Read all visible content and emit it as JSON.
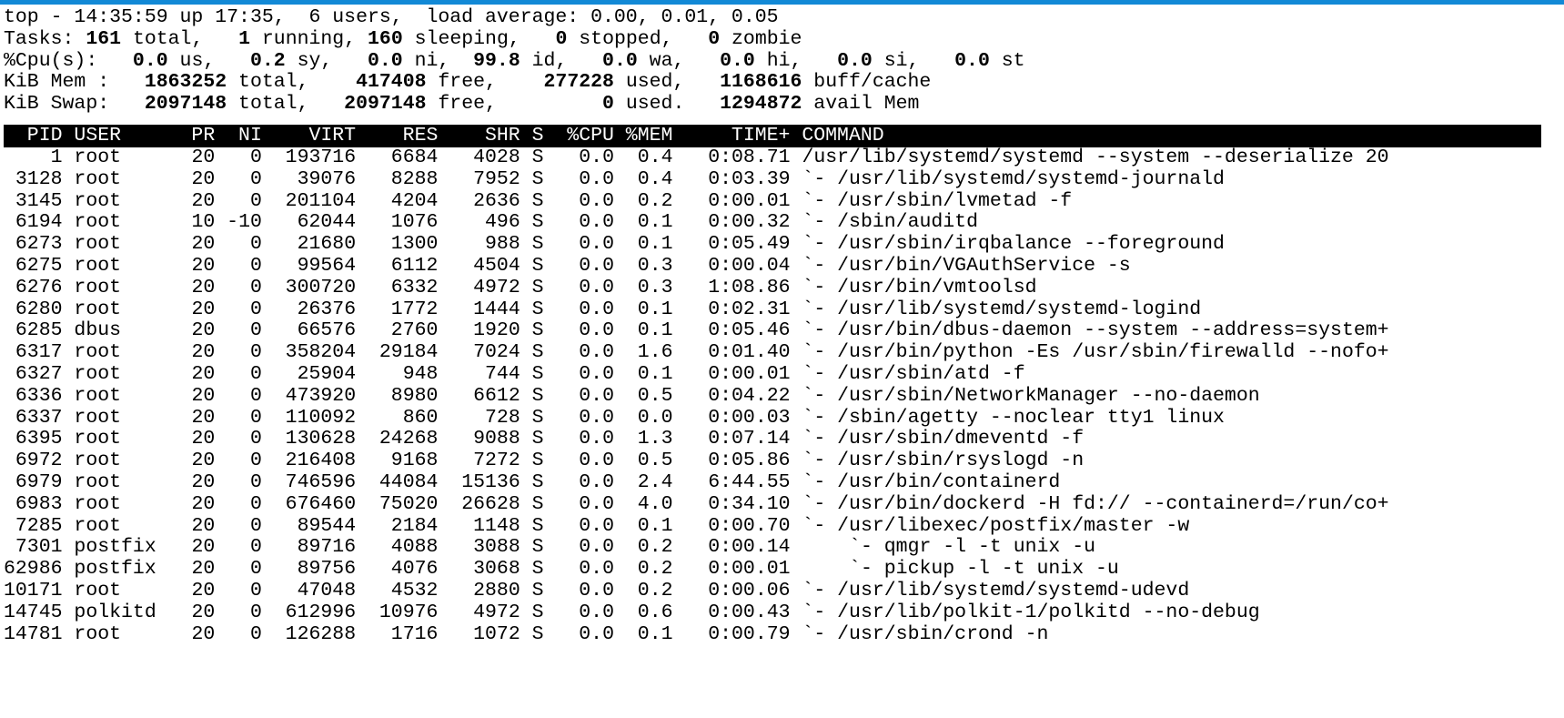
{
  "window": {
    "accent_color": "#1289d6",
    "background_color": "#ffffff",
    "foreground_color": "#000000",
    "header_bar_background": "#000000",
    "header_bar_foreground": "#ffffff"
  },
  "summary": {
    "uptime_line": {
      "program": "top",
      "separator": "-",
      "time": "14:35:59",
      "up_label": "up",
      "uptime": "17:35,",
      "users_count": "6",
      "users_label": "users,",
      "load_label": "load average:",
      "load_1min": "0.00,",
      "load_5min": "0.01,",
      "load_15min": "0.05",
      "text": "top - 14:35:59 up 17:35,  6 users,  load average: 0.00, 0.01, 0.05"
    },
    "tasks_line": {
      "label": "Tasks:",
      "total": "161",
      "total_label": "total,",
      "running": "1",
      "running_label": "running,",
      "sleeping": "160",
      "sleeping_label": "sleeping,",
      "stopped": "0",
      "stopped_label": "stopped,",
      "zombie": "0",
      "zombie_label": "zombie"
    },
    "cpu_line": {
      "label": "%Cpu(s):",
      "us": "0.0",
      "us_label": "us,",
      "sy": "0.2",
      "sy_label": "sy,",
      "ni": "0.0",
      "ni_label": "ni,",
      "id": "99.8",
      "id_label": "id,",
      "wa": "0.0",
      "wa_label": "wa,",
      "hi": "0.0",
      "hi_label": "hi,",
      "si": "0.0",
      "si_label": "si,",
      "st": "0.0",
      "st_label": "st"
    },
    "mem_line": {
      "label": "KiB Mem :",
      "total": "1863252",
      "total_label": "total,",
      "free": "417408",
      "free_label": "free,",
      "used": "277228",
      "used_label": "used,",
      "buff_cache": "1168616",
      "buff_cache_label": "buff/cache"
    },
    "swap_line": {
      "label": "KiB Swap:",
      "total": "2097148",
      "total_label": "total,",
      "free": "2097148",
      "free_label": "free,",
      "used": "0",
      "used_label": "used.",
      "avail": "1294872",
      "avail_label": "avail Mem"
    }
  },
  "columns": {
    "pid": "PID",
    "user": "USER",
    "pr": "PR",
    "ni": "NI",
    "virt": "VIRT",
    "res": "RES",
    "shr": "SHR",
    "s": "S",
    "cpu": "%CPU",
    "mem": "%MEM",
    "time": "TIME+",
    "command": "COMMAND",
    "header_text": "  PID USER      PR  NI    VIRT    RES    SHR S  %CPU %MEM     TIME+ COMMAND"
  },
  "processes": [
    {
      "pid": "1",
      "user": "root",
      "pr": "20",
      "ni": "0",
      "virt": "193716",
      "res": "6684",
      "shr": "4028",
      "s": "S",
      "cpu": "0.0",
      "mem": "0.4",
      "time": "0:08.71",
      "indent": 0,
      "tree": "",
      "command": "/usr/lib/systemd/systemd --system --deserialize 20"
    },
    {
      "pid": "3128",
      "user": "root",
      "pr": "20",
      "ni": "0",
      "virt": "39076",
      "res": "8288",
      "shr": "7952",
      "s": "S",
      "cpu": "0.0",
      "mem": "0.4",
      "time": "0:03.39",
      "indent": 0,
      "tree": "`- ",
      "command": "/usr/lib/systemd/systemd-journald"
    },
    {
      "pid": "3145",
      "user": "root",
      "pr": "20",
      "ni": "0",
      "virt": "201104",
      "res": "4204",
      "shr": "2636",
      "s": "S",
      "cpu": "0.0",
      "mem": "0.2",
      "time": "0:00.01",
      "indent": 0,
      "tree": "`- ",
      "command": "/usr/sbin/lvmetad -f"
    },
    {
      "pid": "6194",
      "user": "root",
      "pr": "10",
      "ni": "-10",
      "virt": "62044",
      "res": "1076",
      "shr": "496",
      "s": "S",
      "cpu": "0.0",
      "mem": "0.1",
      "time": "0:00.32",
      "indent": 0,
      "tree": "`- ",
      "command": "/sbin/auditd"
    },
    {
      "pid": "6273",
      "user": "root",
      "pr": "20",
      "ni": "0",
      "virt": "21680",
      "res": "1300",
      "shr": "988",
      "s": "S",
      "cpu": "0.0",
      "mem": "0.1",
      "time": "0:05.49",
      "indent": 0,
      "tree": "`- ",
      "command": "/usr/sbin/irqbalance --foreground"
    },
    {
      "pid": "6275",
      "user": "root",
      "pr": "20",
      "ni": "0",
      "virt": "99564",
      "res": "6112",
      "shr": "4504",
      "s": "S",
      "cpu": "0.0",
      "mem": "0.3",
      "time": "0:00.04",
      "indent": 0,
      "tree": "`- ",
      "command": "/usr/bin/VGAuthService -s"
    },
    {
      "pid": "6276",
      "user": "root",
      "pr": "20",
      "ni": "0",
      "virt": "300720",
      "res": "6332",
      "shr": "4972",
      "s": "S",
      "cpu": "0.0",
      "mem": "0.3",
      "time": "1:08.86",
      "indent": 0,
      "tree": "`- ",
      "command": "/usr/bin/vmtoolsd"
    },
    {
      "pid": "6280",
      "user": "root",
      "pr": "20",
      "ni": "0",
      "virt": "26376",
      "res": "1772",
      "shr": "1444",
      "s": "S",
      "cpu": "0.0",
      "mem": "0.1",
      "time": "0:02.31",
      "indent": 0,
      "tree": "`- ",
      "command": "/usr/lib/systemd/systemd-logind"
    },
    {
      "pid": "6285",
      "user": "dbus",
      "pr": "20",
      "ni": "0",
      "virt": "66576",
      "res": "2760",
      "shr": "1920",
      "s": "S",
      "cpu": "0.0",
      "mem": "0.1",
      "time": "0:05.46",
      "indent": 0,
      "tree": "`- ",
      "command": "/usr/bin/dbus-daemon --system --address=system+"
    },
    {
      "pid": "6317",
      "user": "root",
      "pr": "20",
      "ni": "0",
      "virt": "358204",
      "res": "29184",
      "shr": "7024",
      "s": "S",
      "cpu": "0.0",
      "mem": "1.6",
      "time": "0:01.40",
      "indent": 0,
      "tree": "`- ",
      "command": "/usr/bin/python -Es /usr/sbin/firewalld --nofo+"
    },
    {
      "pid": "6327",
      "user": "root",
      "pr": "20",
      "ni": "0",
      "virt": "25904",
      "res": "948",
      "shr": "744",
      "s": "S",
      "cpu": "0.0",
      "mem": "0.1",
      "time": "0:00.01",
      "indent": 0,
      "tree": "`- ",
      "command": "/usr/sbin/atd -f"
    },
    {
      "pid": "6336",
      "user": "root",
      "pr": "20",
      "ni": "0",
      "virt": "473920",
      "res": "8980",
      "shr": "6612",
      "s": "S",
      "cpu": "0.0",
      "mem": "0.5",
      "time": "0:04.22",
      "indent": 0,
      "tree": "`- ",
      "command": "/usr/sbin/NetworkManager --no-daemon"
    },
    {
      "pid": "6337",
      "user": "root",
      "pr": "20",
      "ni": "0",
      "virt": "110092",
      "res": "860",
      "shr": "728",
      "s": "S",
      "cpu": "0.0",
      "mem": "0.0",
      "time": "0:00.03",
      "indent": 0,
      "tree": "`- ",
      "command": "/sbin/agetty --noclear tty1 linux"
    },
    {
      "pid": "6395",
      "user": "root",
      "pr": "20",
      "ni": "0",
      "virt": "130628",
      "res": "24268",
      "shr": "9088",
      "s": "S",
      "cpu": "0.0",
      "mem": "1.3",
      "time": "0:07.14",
      "indent": 0,
      "tree": "`- ",
      "command": "/usr/sbin/dmeventd -f"
    },
    {
      "pid": "6972",
      "user": "root",
      "pr": "20",
      "ni": "0",
      "virt": "216408",
      "res": "9168",
      "shr": "7272",
      "s": "S",
      "cpu": "0.0",
      "mem": "0.5",
      "time": "0:05.86",
      "indent": 0,
      "tree": "`- ",
      "command": "/usr/sbin/rsyslogd -n"
    },
    {
      "pid": "6979",
      "user": "root",
      "pr": "20",
      "ni": "0",
      "virt": "746596",
      "res": "44084",
      "shr": "15136",
      "s": "S",
      "cpu": "0.0",
      "mem": "2.4",
      "time": "6:44.55",
      "indent": 0,
      "tree": "`- ",
      "command": "/usr/bin/containerd"
    },
    {
      "pid": "6983",
      "user": "root",
      "pr": "20",
      "ni": "0",
      "virt": "676460",
      "res": "75020",
      "shr": "26628",
      "s": "S",
      "cpu": "0.0",
      "mem": "4.0",
      "time": "0:34.10",
      "indent": 0,
      "tree": "`- ",
      "command": "/usr/bin/dockerd -H fd:// --containerd=/run/co+"
    },
    {
      "pid": "7285",
      "user": "root",
      "pr": "20",
      "ni": "0",
      "virt": "89544",
      "res": "2184",
      "shr": "1148",
      "s": "S",
      "cpu": "0.0",
      "mem": "0.1",
      "time": "0:00.70",
      "indent": 0,
      "tree": "`- ",
      "command": "/usr/libexec/postfix/master -w"
    },
    {
      "pid": "7301",
      "user": "postfix",
      "pr": "20",
      "ni": "0",
      "virt": "89716",
      "res": "4088",
      "shr": "3088",
      "s": "S",
      "cpu": "0.0",
      "mem": "0.2",
      "time": "0:00.14",
      "indent": 1,
      "tree": "`- ",
      "command": "qmgr -l -t unix -u"
    },
    {
      "pid": "62986",
      "user": "postfix",
      "pr": "20",
      "ni": "0",
      "virt": "89756",
      "res": "4076",
      "shr": "3068",
      "s": "S",
      "cpu": "0.0",
      "mem": "0.2",
      "time": "0:00.01",
      "indent": 1,
      "tree": "`- ",
      "command": "pickup -l -t unix -u"
    },
    {
      "pid": "10171",
      "user": "root",
      "pr": "20",
      "ni": "0",
      "virt": "47048",
      "res": "4532",
      "shr": "2880",
      "s": "S",
      "cpu": "0.0",
      "mem": "0.2",
      "time": "0:00.06",
      "indent": 0,
      "tree": "`- ",
      "command": "/usr/lib/systemd/systemd-udevd"
    },
    {
      "pid": "14745",
      "user": "polkitd",
      "pr": "20",
      "ni": "0",
      "virt": "612996",
      "res": "10976",
      "shr": "4972",
      "s": "S",
      "cpu": "0.0",
      "mem": "0.6",
      "time": "0:00.43",
      "indent": 0,
      "tree": "`- ",
      "command": "/usr/lib/polkit-1/polkitd --no-debug"
    },
    {
      "pid": "14781",
      "user": "root",
      "pr": "20",
      "ni": "0",
      "virt": "126288",
      "res": "1716",
      "shr": "1072",
      "s": "S",
      "cpu": "0.0",
      "mem": "0.1",
      "time": "0:00.79",
      "indent": 0,
      "tree": "`- ",
      "command": "/usr/sbin/crond -n"
    }
  ]
}
